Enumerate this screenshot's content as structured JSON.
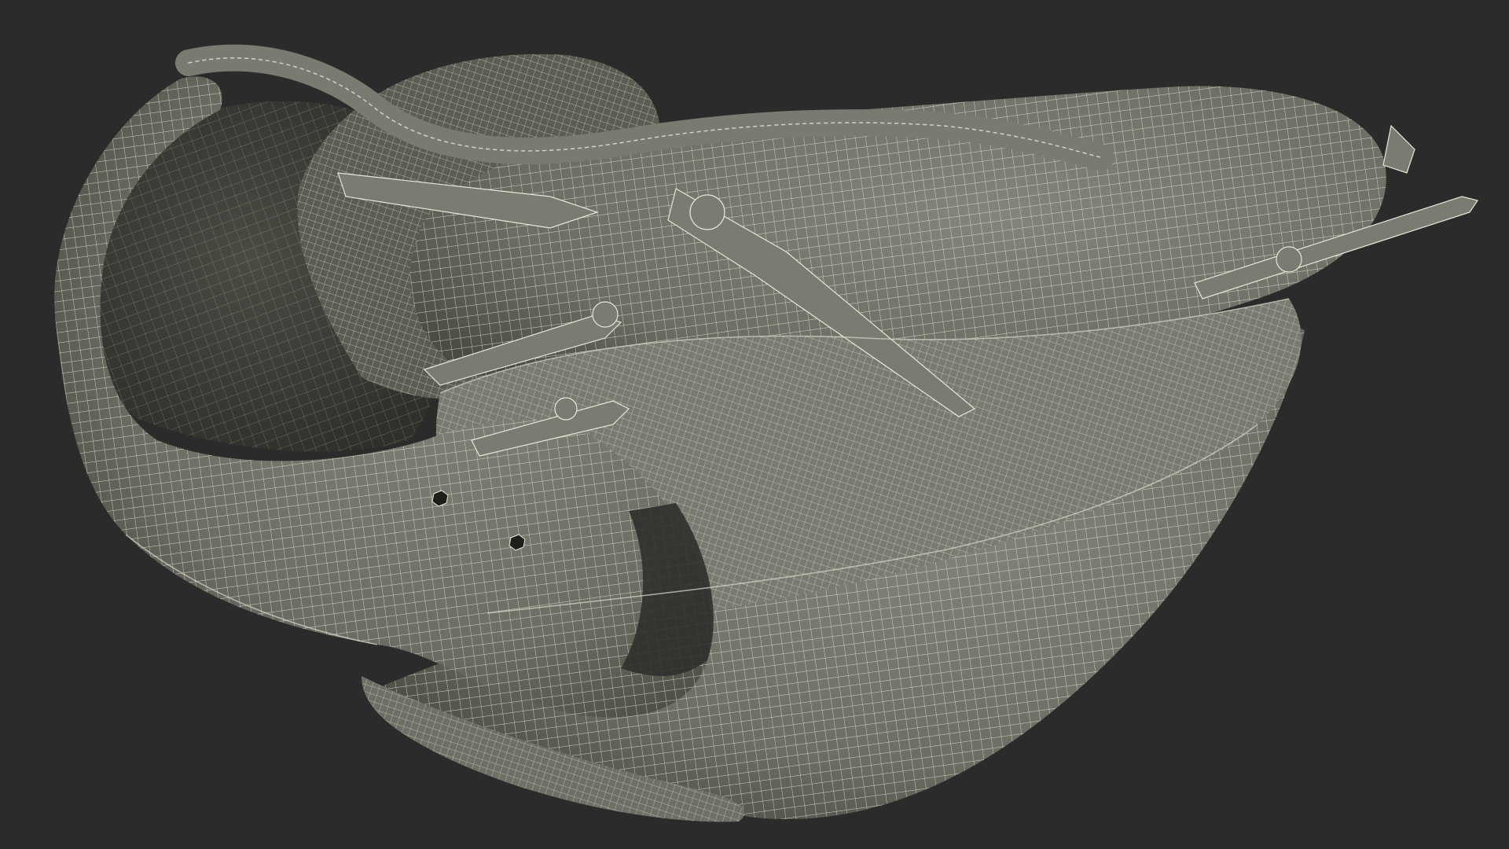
{
  "scene": {
    "subject": "baseball-glove-wireframe",
    "background_color": "#2b2b2b",
    "surface_color": "#75756b",
    "surface_shadow_color": "#45453e",
    "inner_pocket_color": "#3c3d36",
    "wire_color": "#e9e6da",
    "lace_color": "#6c6c62"
  }
}
